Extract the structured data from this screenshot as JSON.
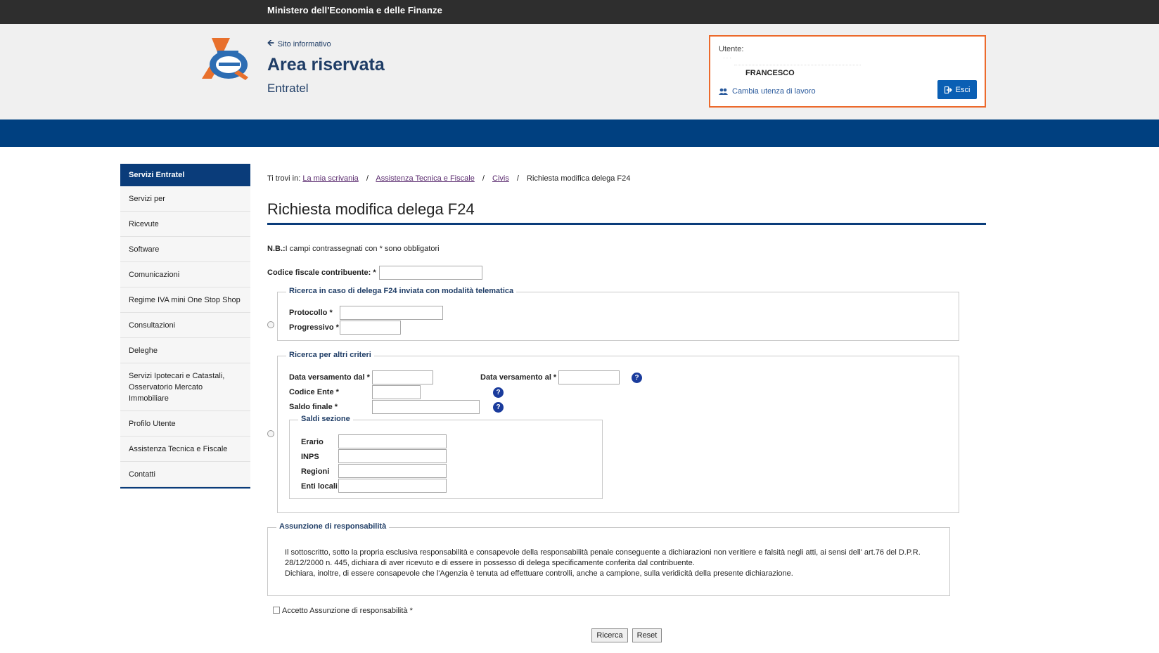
{
  "topbar": {
    "ministry": "Ministero dell'Economia e delle Finanze"
  },
  "header": {
    "back_link": "Sito informativo",
    "area_title": "Area riservata",
    "area_sub": "Entratel"
  },
  "user": {
    "label": "Utente:",
    "name": "FRANCESCO",
    "change_link": "Cambia utenza di lavoro",
    "exit_label": "Esci"
  },
  "sidebar": {
    "title": "Servizi Entratel",
    "items": [
      "Servizi per",
      "Ricevute",
      "Software",
      "Comunicazioni",
      "Regime IVA mini One Stop Shop",
      "Consultazioni",
      "Deleghe",
      "Servizi Ipotecari e Catastali, Osservatorio Mercato Immobiliare",
      "Profilo Utente",
      "Assistenza Tecnica e Fiscale",
      "Contatti"
    ]
  },
  "breadcrumb": {
    "prefix": "Ti trovi in:",
    "links": [
      "La mia scrivania",
      "Assistenza Tecnica e Fiscale",
      "Civis"
    ],
    "sep": "/",
    "current": "Richiesta modifica delega F24"
  },
  "page_title": "Richiesta modifica delega F24",
  "note": {
    "bold": "N.B.:",
    "text": "I campi contrassegnati con * sono obbligatori"
  },
  "form": {
    "cf_label": "Codice fiscale contribuente: *",
    "telematica": {
      "legend": "Ricerca in caso di delega F24 inviata con modalità telematica",
      "protocollo_label": "Protocollo *",
      "progressivo_label": "Progressivo *"
    },
    "altri": {
      "legend": "Ricerca per altri criteri",
      "data_dal_label": "Data versamento dal *",
      "data_al_label": "Data versamento al *",
      "codice_ente_label": "Codice Ente *",
      "saldo_label": "Saldo finale *",
      "help_glyph": "?",
      "saldi": {
        "legend": "Saldi sezione",
        "erario": "Erario",
        "inps": "INPS",
        "regioni": "Regioni",
        "enti": "Enti locali"
      }
    },
    "responsabilita": {
      "legend": "Assunzione di responsabilità",
      "line1": "Il sottoscritto, sotto la propria esclusiva responsabilità e consapevole della responsabilità penale conseguente a dichiarazioni non veritiere e falsità negli atti, ai sensi dell' art.76 del D.P.R. 28/12/2000 n. 445, dichiara di aver ricevuto e di essere in possesso di delega specificamente conferita dal contribuente.",
      "line2": "Dichiara, inoltre, di essere consapevole che l'Agenzia è tenuta ad effettuare controlli, anche a campione, sulla veridicità della presente dichiarazione."
    },
    "accept_label": "Accetto Assunzione di responsabilità *",
    "buttons": {
      "search": "Ricerca",
      "reset": "Reset"
    }
  },
  "colors": {
    "topbar": "#2e2e2e",
    "brand_blue": "#004080",
    "accent_orange": "#ec6a2c",
    "button_blue": "#0a5fb4"
  }
}
